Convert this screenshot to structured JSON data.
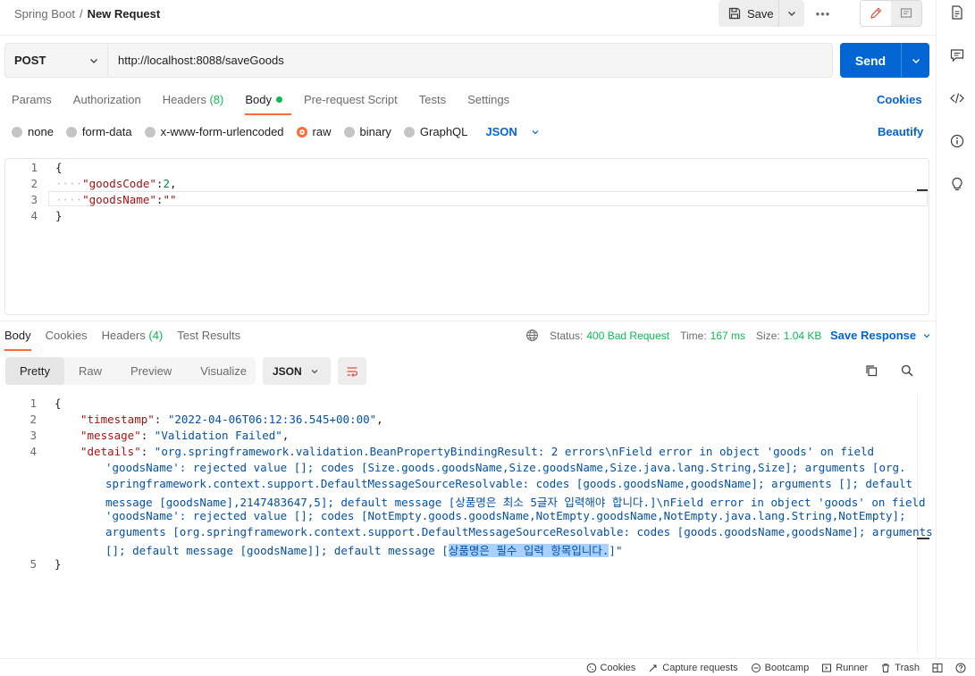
{
  "breadcrumb": {
    "collection": "Spring Boot",
    "separator": "/",
    "request": "New Request"
  },
  "toolbar": {
    "save_label": "Save",
    "more_label": "•••"
  },
  "request": {
    "method": "POST",
    "url": "http://localhost:8088/saveGoods",
    "send_label": "Send"
  },
  "req_tabs": {
    "params": "Params",
    "authorization": "Authorization",
    "headers": "Headers",
    "headers_count": "(8)",
    "body": "Body",
    "prerequest": "Pre-request Script",
    "tests": "Tests",
    "settings": "Settings",
    "cookies": "Cookies"
  },
  "body_types": {
    "none": "none",
    "form_data": "form-data",
    "urlencoded": "x-www-form-urlencoded",
    "raw": "raw",
    "binary": "binary",
    "graphql": "GraphQL",
    "format": "JSON",
    "beautify": "Beautify",
    "selected": "raw"
  },
  "req_body": {
    "line_numbers": [
      "1",
      "2",
      "3",
      "4"
    ],
    "open": "{",
    "k1": "\"goodsCode\"",
    "v1": "2",
    "k2": "\"goodsName\"",
    "v2": "\"\"",
    "close": "}"
  },
  "resp_tabs": {
    "body": "Body",
    "cookies": "Cookies",
    "headers": "Headers",
    "headers_count": "(4)",
    "test_results": "Test Results"
  },
  "resp_meta": {
    "status_label": "Status:",
    "status_value": "400 Bad Request",
    "time_label": "Time:",
    "time_value": "167 ms",
    "size_label": "Size:",
    "size_value": "1.04 KB",
    "save_response": "Save Response"
  },
  "resp_view": {
    "pretty": "Pretty",
    "raw": "Raw",
    "preview": "Preview",
    "visualize": "Visualize",
    "format": "JSON"
  },
  "resp_body": {
    "line_numbers": [
      "1",
      "2",
      "3",
      "4",
      "5"
    ],
    "open": "{",
    "k_timestamp": "\"timestamp\"",
    "v_timestamp": "\"2022-04-06T06:12:36.545+00:00\"",
    "k_message": "\"message\"",
    "v_message": "\"Validation Failed\"",
    "k_details": "\"details\"",
    "details_lines": [
      "\"org.springframework.validation.BeanPropertyBindingResult: 2 errors\\nField error in object 'goods' on field",
      "'goodsName': rejected value []; codes [Size.goods.goodsName,Size.goodsName,Size.java.lang.String,Size]; arguments [org.",
      "springframework.context.support.DefaultMessageSourceResolvable: codes [goods.goodsName,goodsName]; arguments []; default",
      "message [goodsName],2147483647,5]; default message [상품명은 최소 5글자 입력해야 합니다.]\\nField error in object 'goods' on field",
      "'goodsName': rejected value []; codes [NotEmpty.goods.goodsName,NotEmpty.goodsName,NotEmpty.java.lang.String,NotEmpty];",
      "arguments [org.springframework.context.support.DefaultMessageSourceResolvable: codes [goods.goodsName,goodsName]; arguments"
    ],
    "details_last_prefix": "[]; default message [goodsName]]; default message [",
    "details_last_selected": "상품명은 필수 입력 항목입니다.",
    "details_last_suffix": "]\"",
    "close": "}"
  },
  "statusbar": {
    "cookies": "Cookies",
    "capture": "Capture requests",
    "bootcamp": "Bootcamp",
    "runner": "Runner",
    "trash": "Trash"
  },
  "colors": {
    "accent_orange": "#ff6c37",
    "brand_blue": "#0265d2",
    "success_green": "#0cbb52",
    "selection": "#a9d1ff"
  }
}
